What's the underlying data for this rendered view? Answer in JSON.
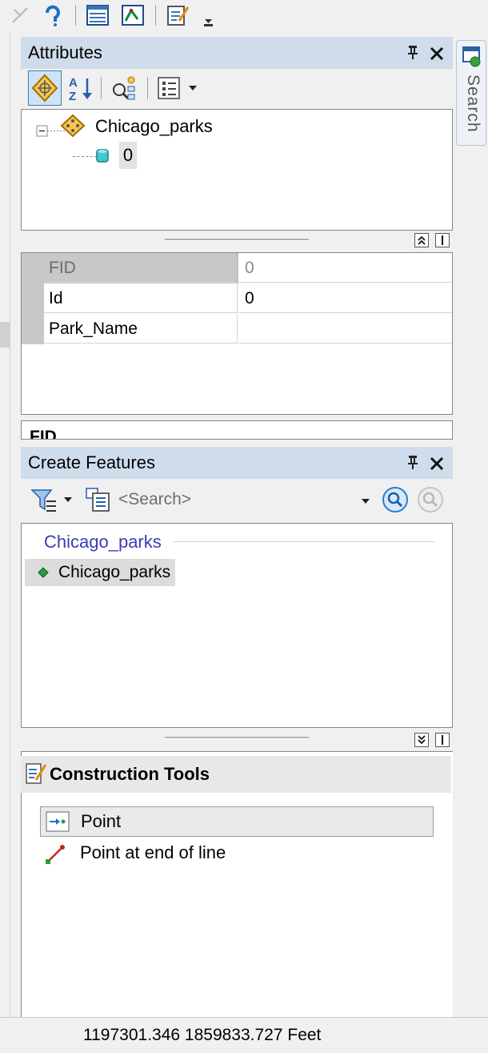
{
  "attributes_panel": {
    "title": "Attributes",
    "pin_glyph": "Ρ",
    "close_glyph": "✕",
    "tree": {
      "layer": "Chicago_parks",
      "feature": "0"
    },
    "fields": [
      {
        "name": "FID",
        "value": "0",
        "readonly": true
      },
      {
        "name": "Id",
        "value": "0",
        "readonly": false
      },
      {
        "name": "Park_Name",
        "value": "",
        "readonly": false
      }
    ],
    "description_field": "FID"
  },
  "create_features_panel": {
    "title": "Create Features",
    "search_placeholder": "<Search>",
    "group_label": "Chicago_parks",
    "template_item": "Chicago_parks"
  },
  "construction_tools": {
    "title": "Construction Tools",
    "tools": [
      {
        "label": "Point",
        "selected": true,
        "icon": "point-tool-icon"
      },
      {
        "label": "Point at end of line",
        "selected": false,
        "icon": "point-at-end-of-line-icon"
      }
    ]
  },
  "search_tab": {
    "label": "Search"
  },
  "status_bar": {
    "coordinates": "1197301.346  1859833.727 Feet"
  },
  "colors": {
    "panel_header": "#cfdcec",
    "group_label": "#3c3cb4",
    "selection": "#dcdcdc",
    "accent_blue": "#1c6fc4"
  }
}
